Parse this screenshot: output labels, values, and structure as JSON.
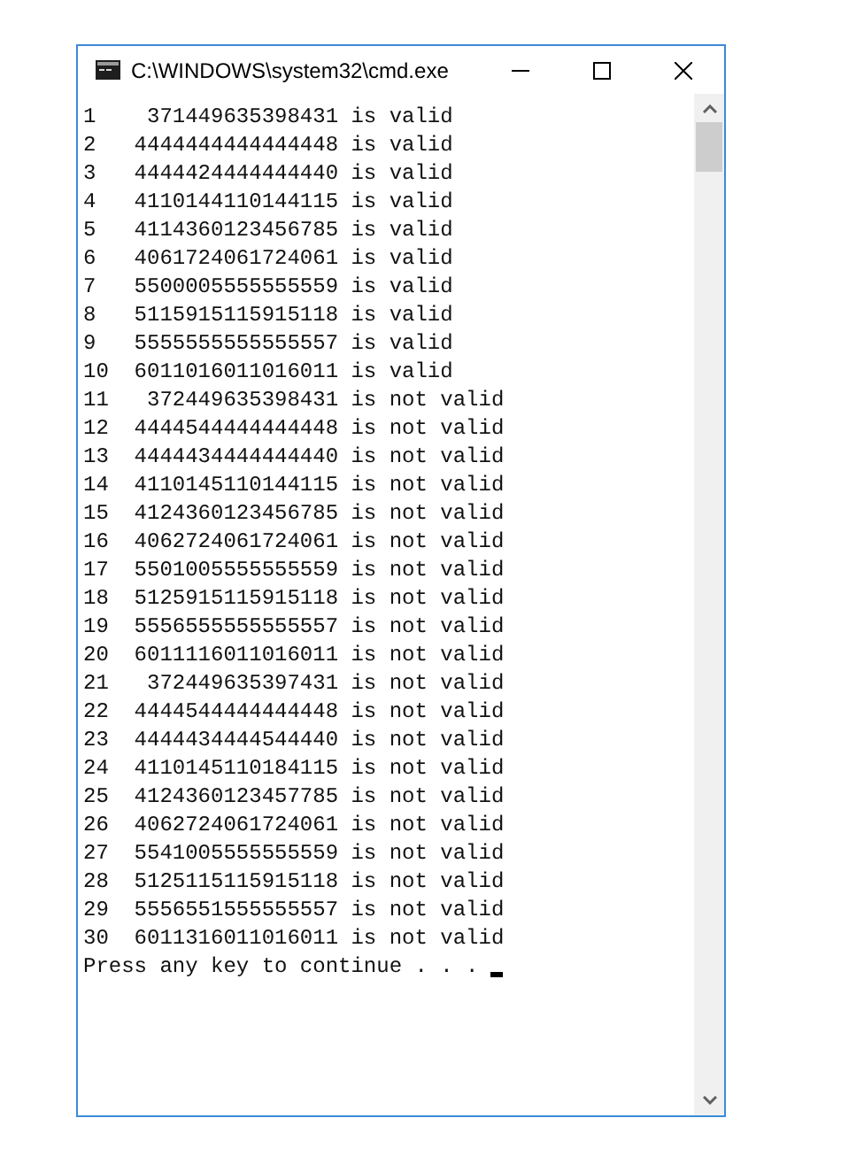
{
  "window": {
    "title": "C:\\WINDOWS\\system32\\cmd.exe"
  },
  "console": {
    "lines": [
      "1    371449635398431 is valid",
      "2   4444444444444448 is valid",
      "3   4444424444444440 is valid",
      "4   4110144110144115 is valid",
      "5   4114360123456785 is valid",
      "6   4061724061724061 is valid",
      "7   5500005555555559 is valid",
      "8   5115915115915118 is valid",
      "9   5555555555555557 is valid",
      "10  6011016011016011 is valid",
      "11   372449635398431 is not valid",
      "12  4444544444444448 is not valid",
      "13  4444434444444440 is not valid",
      "14  4110145110144115 is not valid",
      "15  4124360123456785 is not valid",
      "16  4062724061724061 is not valid",
      "17  5501005555555559 is not valid",
      "18  5125915115915118 is not valid",
      "19  5556555555555557 is not valid",
      "20  6011116011016011 is not valid",
      "21   372449635397431 is not valid",
      "22  4444544444444448 is not valid",
      "23  4444434444544440 is not valid",
      "24  4110145110184115 is not valid",
      "25  4124360123457785 is not valid",
      "26  4062724061724061 is not valid",
      "27  5541005555555559 is not valid",
      "28  5125115115915118 is not valid",
      "29  5556551555555557 is not valid",
      "30  6011316011016011 is not valid"
    ],
    "prompt": "Press any key to continue . . . ",
    "cursor_visible": true
  }
}
